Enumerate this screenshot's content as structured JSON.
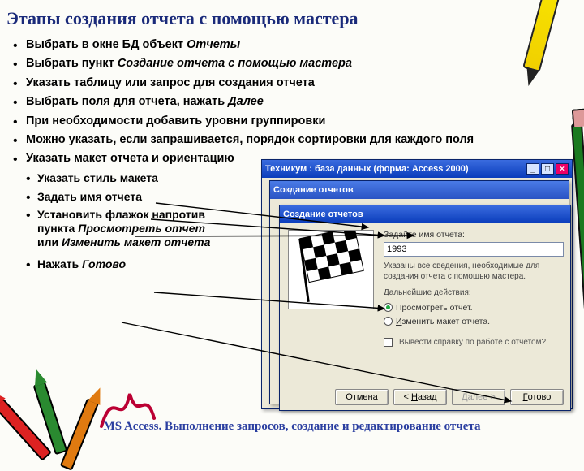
{
  "title": "Этапы создания отчета с помощью мастера",
  "bullets": {
    "b1a": "Выбрать в окне БД объект ",
    "b1b": "Отчеты",
    "b2a": "Выбрать пункт ",
    "b2b": "Создание отчета с помощью мастера",
    "b3": "Указать таблицу или запрос для создания отчета",
    "b4a": "Выбрать поля для отчета, нажать ",
    "b4b": "Далее",
    "b5": "При необходимости добавить уровни группировки",
    "b6": "Можно указать, если запрашивается, порядок сортировки для каждого поля",
    "b7": "Указать макет отчета и ориентацию",
    "b8": "Указать стиль макета",
    "b9": "Задать имя отчета",
    "b10a": "Установить флажок напротив пункта ",
    "b10b": "Просмотреть отчет",
    "b10c": " или ",
    "b10d": "Изменить макет отчета",
    "b11a": "Нажать ",
    "b11b": "Готово"
  },
  "win": {
    "app_title": "Техникум : база данных (форма: Access 2000)",
    "wiz_title": "Создание отчетов",
    "name_label": "Задайте имя отчета:",
    "name_value": "1993",
    "desc1": "Указаны все сведения, необходимые для создания отчета с помощью мастера.",
    "desc2": "Дальнейшие действия:",
    "radio_view": "Просмотреть отчет.",
    "radio_edit": "Изменить макет отчета.",
    "check_help": "Вывести справку по работе с отчетом?",
    "btn_cancel": "Отмена",
    "btn_back": "< Назад",
    "btn_next": "Далее >",
    "btn_done": "Готово"
  },
  "footer": "MS Access. Выполнение запросов, создание и редактирование отчета"
}
